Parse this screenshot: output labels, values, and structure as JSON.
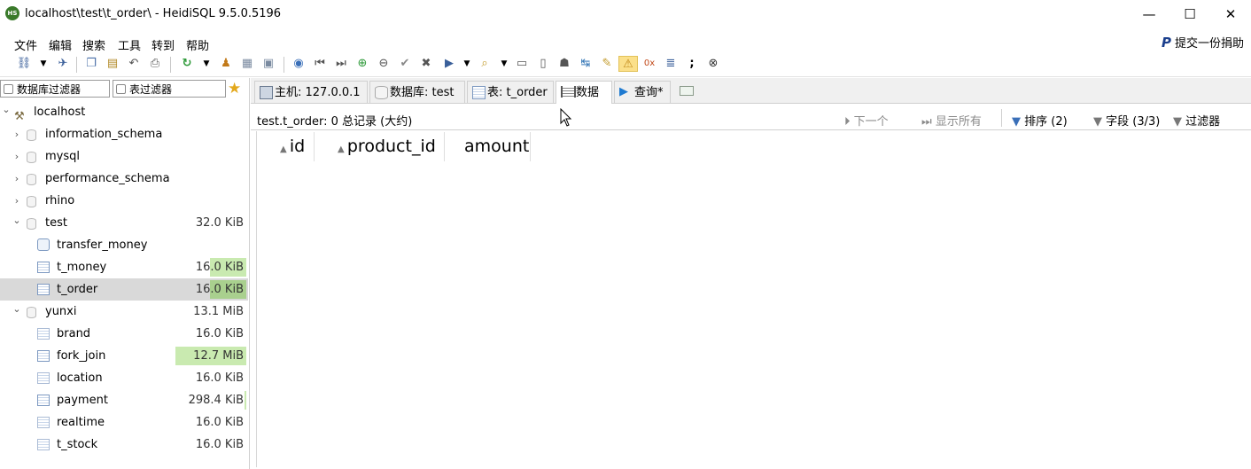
{
  "window": {
    "title": "localhost\\test\\t_order\\ - HeidiSQL 9.5.0.5196",
    "app_icon_text": "HS",
    "minimize": "—",
    "maximize": "☐",
    "close": "✕"
  },
  "menu": {
    "items": [
      "文件",
      "编辑",
      "搜索",
      "工具",
      "转到",
      "帮助"
    ],
    "donate": "提交一份捐助",
    "donate_icon": "paypal-icon"
  },
  "left": {
    "db_filter_placeholder": "数据库过滤器",
    "table_filter_placeholder": "表过滤器",
    "tree": [
      {
        "label": "localhost",
        "size": "",
        "level": 0,
        "icon": "server-icon",
        "expanded": true
      },
      {
        "label": "information_schema",
        "size": "",
        "level": 1,
        "icon": "database-icon",
        "expanded": false
      },
      {
        "label": "mysql",
        "size": "",
        "level": 1,
        "icon": "database-icon",
        "expanded": false
      },
      {
        "label": "performance_schema",
        "size": "",
        "level": 1,
        "icon": "database-icon",
        "expanded": false
      },
      {
        "label": "rhino",
        "size": "",
        "level": 1,
        "icon": "database-icon",
        "expanded": false
      },
      {
        "label": "test",
        "size": "32.0 KiB",
        "level": 1,
        "icon": "database-icon",
        "expanded": true
      },
      {
        "label": "transfer_money",
        "size": "",
        "level": 2,
        "icon": "procedure-icon"
      },
      {
        "label": "t_money",
        "size": "16.0 KiB",
        "level": 2,
        "icon": "table-icon",
        "bar": 0.5
      },
      {
        "label": "t_order",
        "size": "16.0 KiB",
        "level": 2,
        "icon": "table-icon",
        "bar": 0.5,
        "selected": true
      },
      {
        "label": "yunxi",
        "size": "13.1 MiB",
        "level": 1,
        "icon": "database-icon",
        "expanded": true
      },
      {
        "label": "brand",
        "size": "16.0 KiB",
        "level": 2,
        "icon": "table-icon"
      },
      {
        "label": "fork_join",
        "size": "12.7 MiB",
        "level": 2,
        "icon": "table-icon",
        "bar": 0.97
      },
      {
        "label": "location",
        "size": "16.0 KiB",
        "level": 2,
        "icon": "table-icon"
      },
      {
        "label": "payment",
        "size": "298.4 KiB",
        "level": 2,
        "icon": "table-icon",
        "bar": 0.02
      },
      {
        "label": "realtime",
        "size": "16.0 KiB",
        "level": 2,
        "icon": "table-icon"
      },
      {
        "label": "t_stock",
        "size": "16.0 KiB",
        "level": 2,
        "icon": "table-icon"
      }
    ]
  },
  "tabs": [
    {
      "label": "主机: 127.0.0.1",
      "icon": "host-icon"
    },
    {
      "label": "数据库: test",
      "icon": "database-icon"
    },
    {
      "label": "表: t_order",
      "icon": "table-icon"
    },
    {
      "label": "数据",
      "icon": "data-grid-icon",
      "active": true
    },
    {
      "label": "查询*",
      "icon": "play-icon"
    },
    {
      "label": "",
      "icon": "new-query-tab-icon"
    }
  ],
  "data_view": {
    "status": "test.t_order: 0 总记录 (大约)",
    "next": "下一个",
    "show_all": "显示所有",
    "sort": "排序 (2)",
    "columns": "字段 (3/3)",
    "filter": "过滤器",
    "headers": [
      "id",
      "product_id",
      "amount"
    ]
  }
}
